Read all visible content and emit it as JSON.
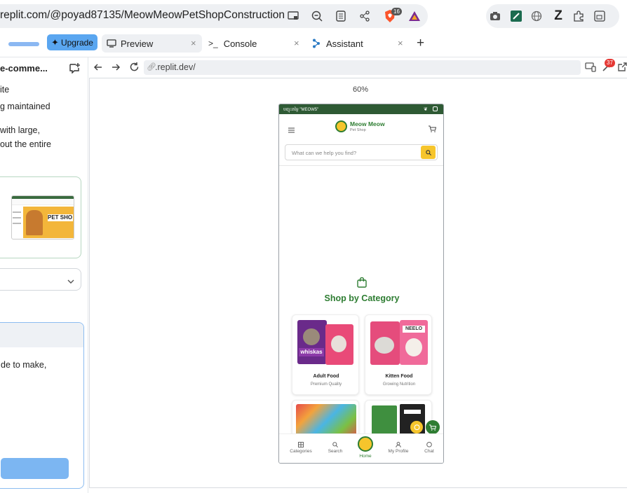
{
  "browser": {
    "url": "replit.com/@poyad87135/MeowMeowPetShopConstruction",
    "brave_badge": "16"
  },
  "replit": {
    "upgrade_label": "Upgrade",
    "tabs": [
      {
        "label": "Preview"
      },
      {
        "label": "Console"
      },
      {
        "label": "Assistant"
      }
    ],
    "preview_url": ".replit.dev/",
    "zoom": "60%",
    "devtools_badge": "37"
  },
  "left_pane": {
    "title": "e-comme...",
    "lines": [
      "ite",
      "g maintained",
      "with large,",
      "out the entire"
    ],
    "chat_text": "de to make,"
  },
  "app": {
    "topbar_text": "បញ្ចុះតម្លៃ \"MEOW5\"",
    "brand_name": "Meow Meow",
    "brand_sub": "Pet Shop",
    "search_placeholder": "What can we help you find?",
    "section_title": "Shop by Category",
    "categories": [
      {
        "title": "Adult Food",
        "subtitle": "Premium Quality"
      },
      {
        "title": "Kitten Food",
        "subtitle": "Growing Nutrition"
      }
    ],
    "nav": [
      {
        "label": "Categories"
      },
      {
        "label": "Search"
      },
      {
        "label": "Home"
      },
      {
        "label": "My Profile"
      },
      {
        "label": "Chat"
      }
    ],
    "colors": {
      "primary": "#2e7d32",
      "accent": "#f6c52c",
      "topbar": "#2e5a34"
    }
  }
}
